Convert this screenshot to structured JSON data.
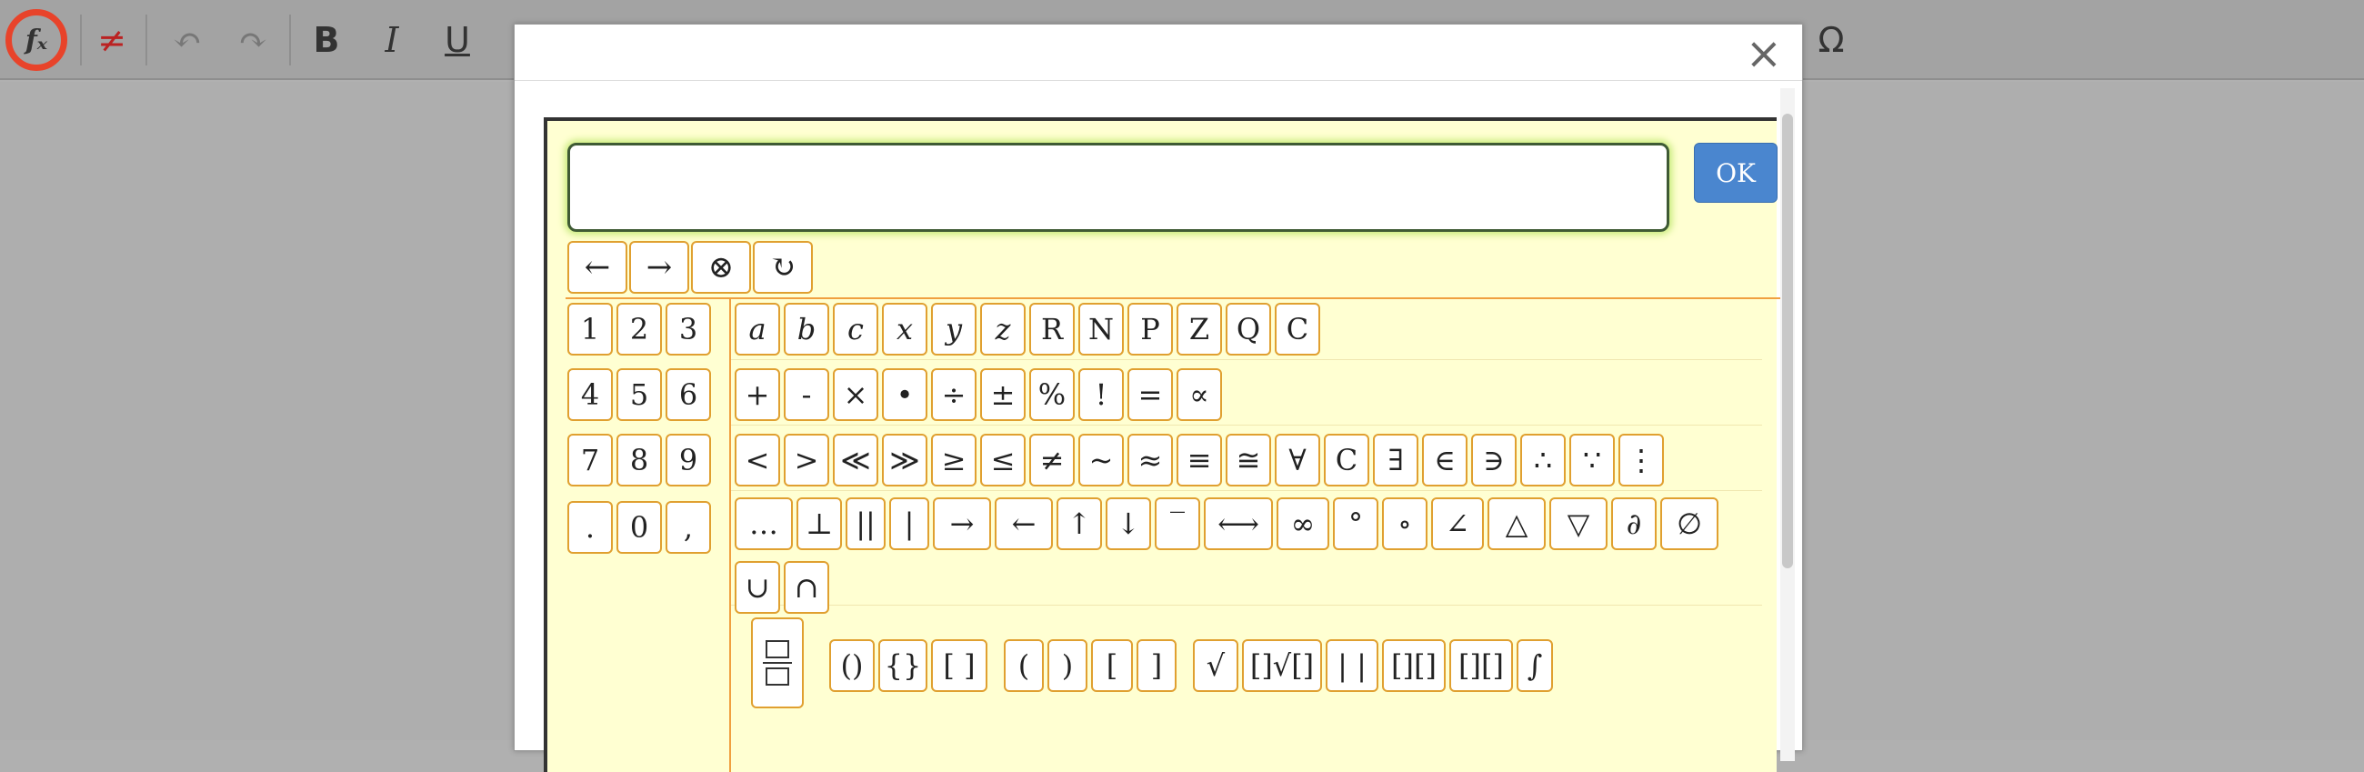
{
  "toolbar": {
    "fx": "fₓ",
    "strike": "≠",
    "undo": "↶",
    "redo": "↷",
    "bold": "B",
    "italic": "I",
    "underline": "U",
    "omega": "Ω"
  },
  "modal": {
    "close": "×",
    "ok": "OK",
    "controls": [
      "←",
      "→",
      "⊗",
      "↻"
    ],
    "digits": [
      "1",
      "2",
      "3",
      "4",
      "5",
      "6",
      "7",
      "8",
      "9",
      ".",
      "0",
      ","
    ],
    "letters": [
      "a",
      "b",
      "c",
      "x",
      "y",
      "z",
      "R",
      "N",
      "P",
      "Z",
      "Q",
      "C"
    ],
    "operators": [
      "+",
      "-",
      "×",
      "•",
      "÷",
      "±",
      "%",
      "!",
      "=",
      "∝"
    ],
    "relations": [
      "<",
      ">",
      "≪",
      "≫",
      "≥",
      "≤",
      "≠",
      "~",
      "≈",
      "≡",
      "≅",
      "∀",
      "C",
      "∃",
      "∈",
      "∋",
      "∴",
      "∵",
      "⋮"
    ],
    "symbols": [
      "…",
      "⊥",
      "||",
      "|",
      "→",
      "←",
      "↑",
      "↓",
      "‾",
      "⟷",
      "∞",
      "°",
      "∘",
      "∠",
      "△",
      "▽",
      "∂",
      "∅",
      "∪",
      "∩"
    ],
    "templates": [
      "()",
      "{}",
      "[ ]",
      "(",
      ")",
      "[",
      "]",
      "√",
      "[]√[]",
      "| |",
      "[][]",
      "[][]",
      "∫"
    ]
  }
}
